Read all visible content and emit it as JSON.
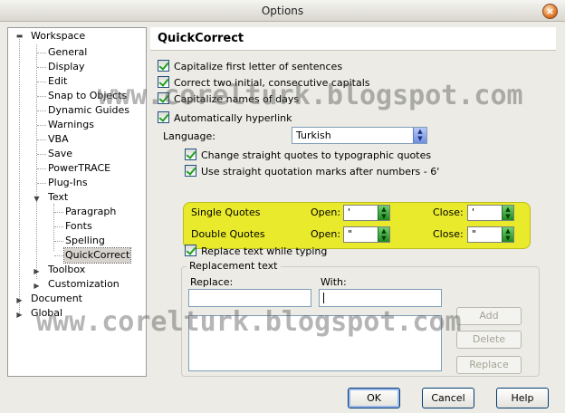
{
  "window": {
    "title": "Options"
  },
  "tree": {
    "items": [
      {
        "label": "Workspace",
        "expander": "▬"
      },
      {
        "label": "General"
      },
      {
        "label": "Display"
      },
      {
        "label": "Edit"
      },
      {
        "label": "Snap to Objects"
      },
      {
        "label": "Dynamic Guides"
      },
      {
        "label": "Warnings"
      },
      {
        "label": "VBA"
      },
      {
        "label": "Save"
      },
      {
        "label": "PowerTRACE"
      },
      {
        "label": "Plug-Ins"
      },
      {
        "label": "Text",
        "expander": "▼"
      },
      {
        "label": "Paragraph"
      },
      {
        "label": "Fonts"
      },
      {
        "label": "Spelling"
      },
      {
        "label": "QuickCorrect"
      },
      {
        "label": "Toolbox",
        "expander": "▶"
      },
      {
        "label": "Customization",
        "expander": "▶"
      },
      {
        "label": "Document",
        "expander": "▶"
      },
      {
        "label": "Global",
        "expander": "▶"
      }
    ]
  },
  "panel": {
    "title": "QuickCorrect",
    "checks": {
      "capitalize_first": "Capitalize first letter of sentences",
      "correct_two_initial": "Correct two initial, consecutive capitals",
      "capitalize_days": "Capitalize names of days",
      "auto_hyperlink": "Automatically hyperlink"
    },
    "language_label": "Language:",
    "language_value": "Turkish",
    "typographic_quotes": "Change straight quotes to typographic quotes",
    "straight_after_numbers": "Use straight quotation marks after numbers - 6'",
    "single_quotes": {
      "label": "Single Quotes",
      "open_label": "Open:",
      "open_value": "'",
      "close_label": "Close:",
      "close_value": "'"
    },
    "double_quotes": {
      "label": "Double Quotes",
      "open_label": "Open:",
      "open_value": "\"",
      "close_label": "Close:",
      "close_value": "\""
    },
    "replace_while_typing": "Replace text while typing",
    "replacement_group": "Replacement text",
    "replace_label": "Replace:",
    "with_label": "With:",
    "add": "Add",
    "delete": "Delete",
    "replace": "Replace"
  },
  "buttons": {
    "ok": "OK",
    "cancel": "Cancel",
    "help": "Help"
  },
  "watermark": "www.corelturk.blogspot.com"
}
